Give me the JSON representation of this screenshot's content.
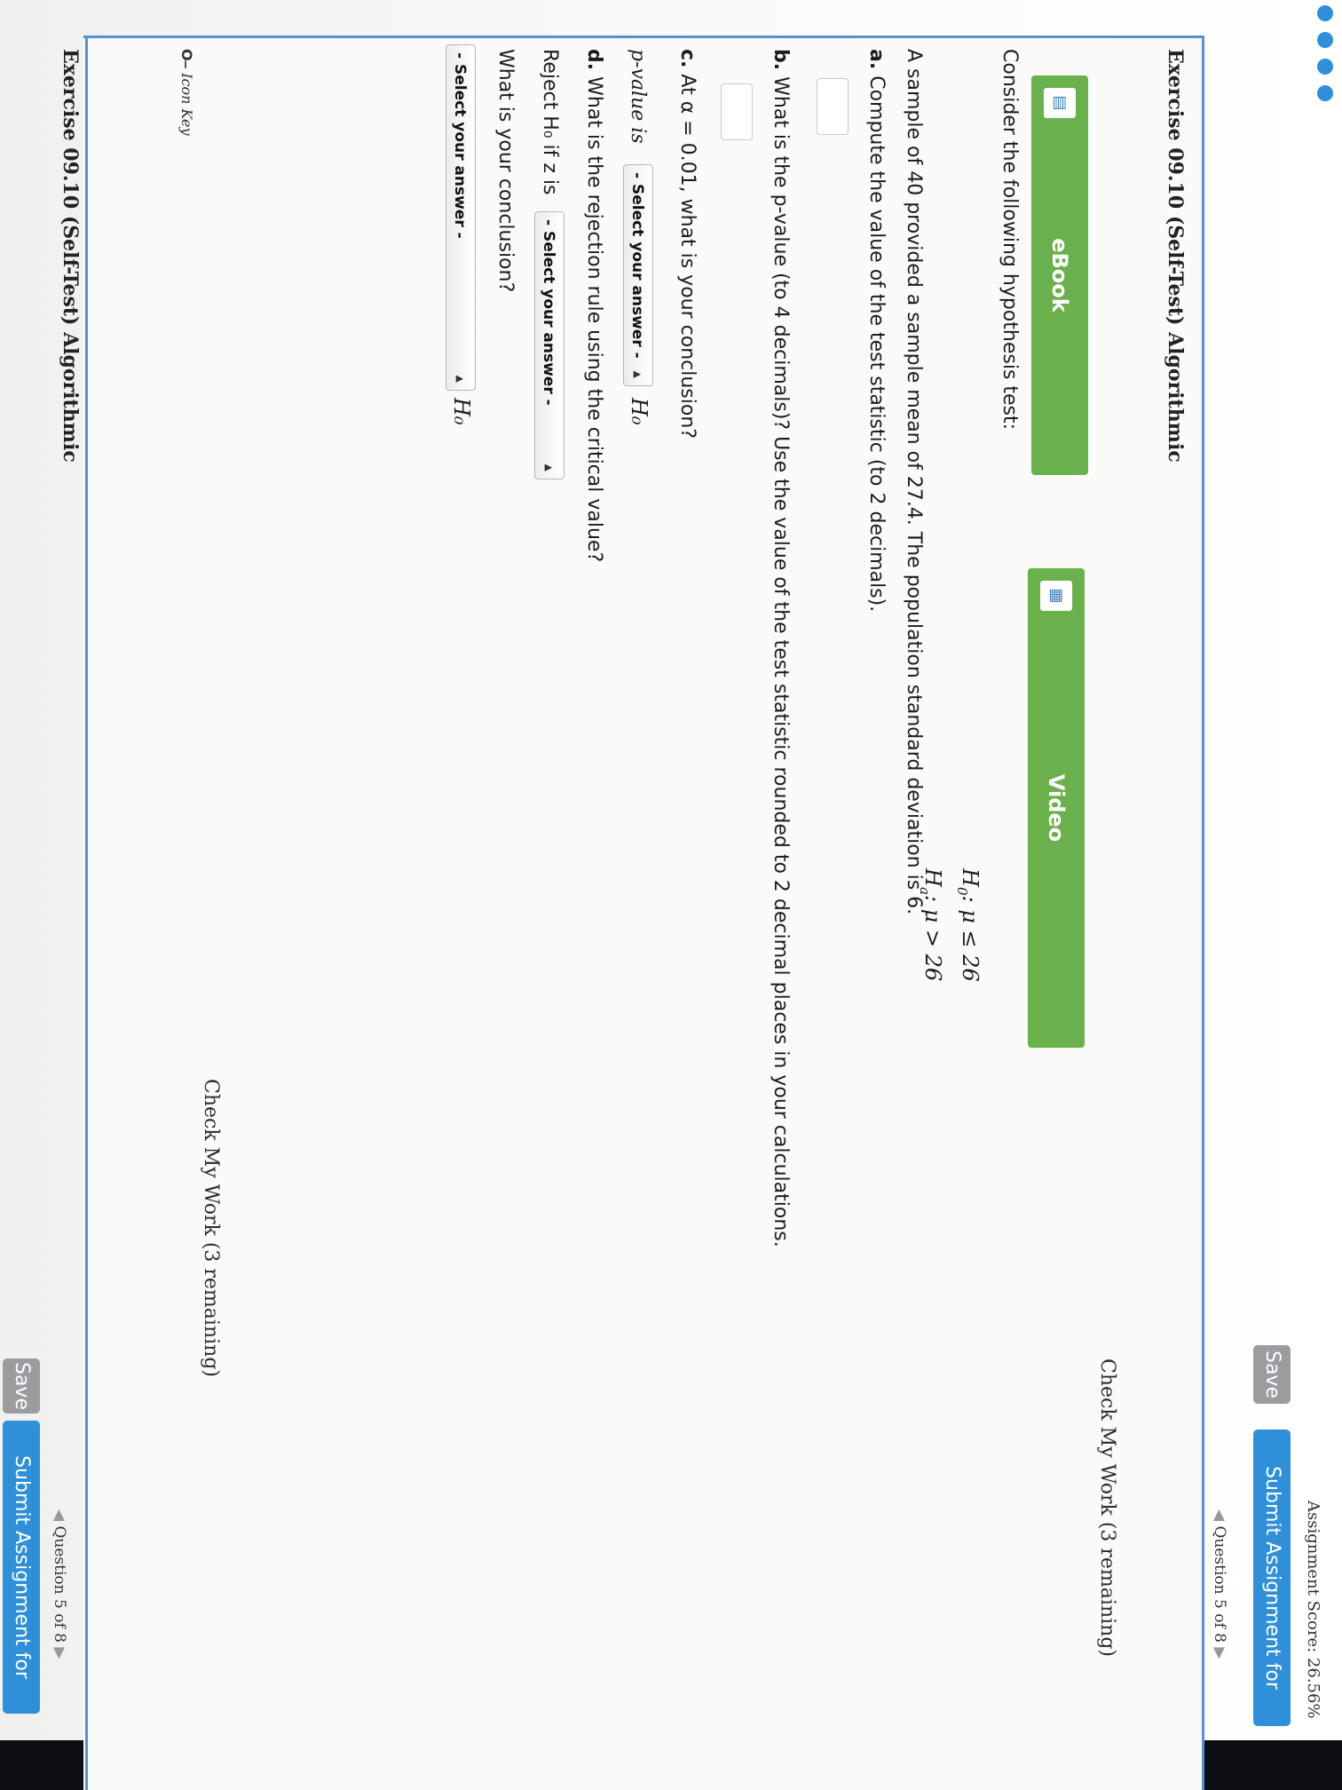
{
  "header": {
    "assignment_score": "Assignment Score: 26.56%",
    "save_label": "Save",
    "submit_label": "Submit Assignment for Grading",
    "question_nav": "Question 5 of 8"
  },
  "exercise": {
    "title": "Exercise 09.10 (Self-Test) Algorithmic",
    "check_my_work": "Check My Work (3 remaining)"
  },
  "resources": {
    "ebook_label": "eBook",
    "video_label": "Video"
  },
  "question": {
    "intro": "Consider the following hypothesis test:",
    "h0_left": "H",
    "h0_sub": "0",
    "h0_rest": ": μ ≤ 26",
    "ha_left": "H",
    "ha_sub": "a",
    "ha_rest": ": μ > 26",
    "sample_text": "A sample of 40 provided a sample mean of 27.4. The population standard deviation is 6.",
    "part_a_label": "a.",
    "part_a_text": "Compute the value of the test statistic (to 2 decimals).",
    "part_b_label": "b.",
    "part_b_text": "What is the p-value (to 4 decimals)? Use the value of the test statistic rounded to 2 decimal places in your calculations.",
    "part_c_label": "c.",
    "part_c_text": "At α = 0.01, what is your conclusion?",
    "pvalue_prefix": "p-value is",
    "select_placeholder": "- Select your answer -",
    "h0_suffix": "H₀",
    "part_d_label": "d.",
    "part_d_text": "What is the rejection rule using the critical value?",
    "reject_prefix": "Reject H₀ if z is",
    "conclusion_text": "What is your conclusion?"
  },
  "footer": {
    "icon_key": "Icon Key",
    "check_my_work": "Check My Work (3 remaining)",
    "exercise_title": "Exercise 09.10 (Self-Test) Algorithmic",
    "save_label": "Save",
    "submit_label": "Submit Assignment for Grading",
    "question_nav": "Question 5 of 8"
  },
  "colors": {
    "green": "#6ab04c",
    "blue": "#2f8fd8",
    "panel_border": "#5a8fd0"
  }
}
